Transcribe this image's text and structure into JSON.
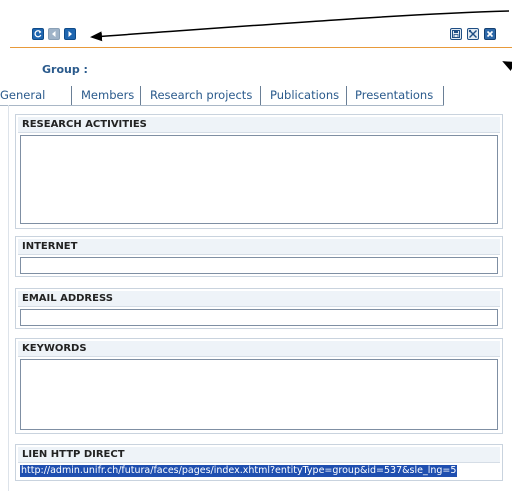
{
  "toolbar": {
    "left_buttons": [
      {
        "icon": "refresh-icon"
      },
      {
        "icon": "previous-icon"
      },
      {
        "icon": "next-icon"
      }
    ],
    "right_buttons": [
      {
        "icon": "save-icon"
      },
      {
        "icon": "tools-icon"
      },
      {
        "icon": "close-icon"
      }
    ]
  },
  "header": {
    "group_label": "Group :"
  },
  "tabs": [
    {
      "label": "General",
      "active": true
    },
    {
      "label": "Members",
      "active": false
    },
    {
      "label": "Research projects",
      "active": false
    },
    {
      "label": "Publications",
      "active": false
    },
    {
      "label": "Presentations",
      "active": false
    }
  ],
  "sections": {
    "research_activities": {
      "title": "RESEARCH ACTIVITIES",
      "value": ""
    },
    "internet": {
      "title": "INTERNET",
      "value": ""
    },
    "email": {
      "title": "EMAIL ADDRESS",
      "value": ""
    },
    "keywords": {
      "title": "KEYWORDS",
      "value": ""
    },
    "direct_link": {
      "title": "LIEN HTTP DIRECT",
      "value": "http://admin.unifr.ch/futura/faces/pages/index.xhtml?entityType=group&id=537&sle_lng=5"
    }
  },
  "colors": {
    "accent_orange": "#e89a3a",
    "button_blue": "#1f66b0",
    "label_blue": "#2a5a8c",
    "selection_blue": "#1f4fb0"
  }
}
